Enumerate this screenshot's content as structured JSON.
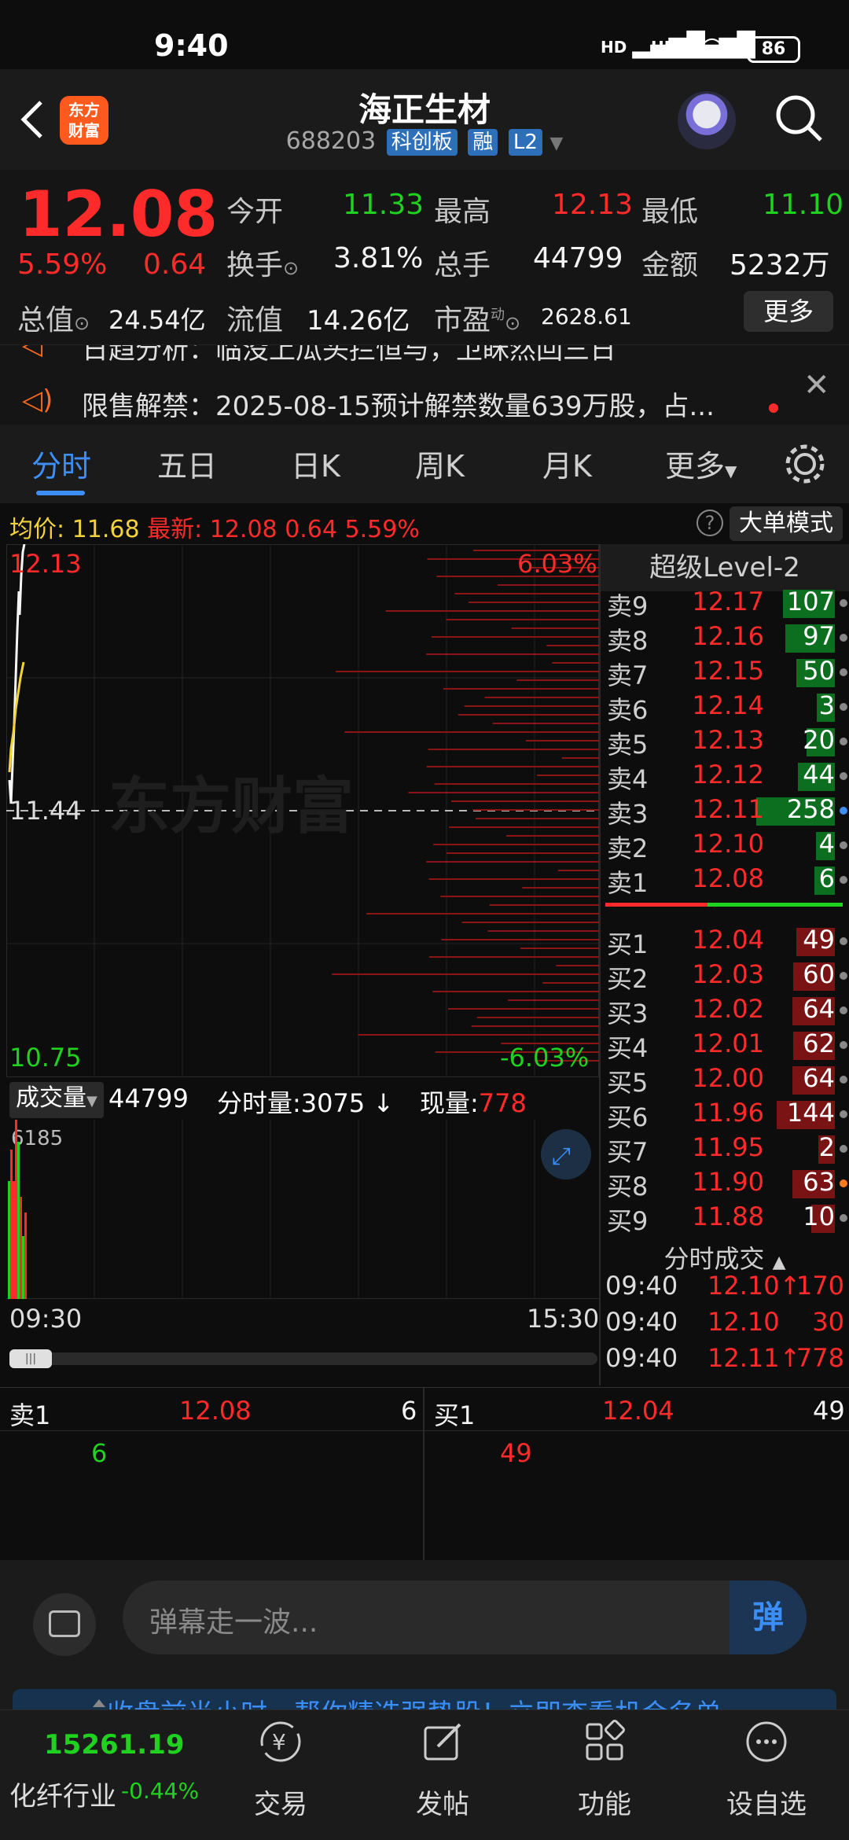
{
  "status": {
    "time": "9:40",
    "sig1": "HD",
    "sig2": "HD",
    "battery": "86"
  },
  "header": {
    "logo_line1": "东方",
    "logo_line2": "财富",
    "title": "海正生材",
    "code": "688203",
    "tag1": "科创板",
    "tag2": "融",
    "tag3": "L2"
  },
  "quote": {
    "price": "12.08",
    "change_pct": "5.59%",
    "change": "0.64",
    "open_label": "今开",
    "open": "11.33",
    "high_label": "最高",
    "high": "12.13",
    "low_label": "最低",
    "low": "11.10",
    "turnover_label": "换手",
    "turnover": "3.81%",
    "volume_label": "总手",
    "volume": "44799",
    "amount_label": "金额",
    "amount": "5232万",
    "mktcap_label": "总值",
    "mktcap": "24.54亿",
    "float_label": "流值",
    "float": "14.26亿",
    "pe_label": "市盈",
    "pe_sup": "动",
    "pe": "2628.61",
    "more": "更多"
  },
  "notice": {
    "line1": "日趋分析：临没上瓜头拦恒与，卫眯然回三日",
    "line2": "限售解禁：2025-08-15预计解禁数量639万股，占..."
  },
  "tabs": [
    "分时",
    "五日",
    "日K",
    "周K",
    "月K",
    "更多"
  ],
  "avgbar": {
    "avg_label": "均价:",
    "avg": "11.68",
    "latest_label": "最新:",
    "latest": "12.08",
    "chg": "0.64",
    "pct": "5.59%",
    "help": "?",
    "mode": "大单模式"
  },
  "chart_labels": {
    "top": "12.13",
    "top_pct": "6.03%",
    "mid": "11.44",
    "bottom": "10.75",
    "bottom_pct": "-6.03%",
    "watermark": "东方财富",
    "vol_max": "6185",
    "time_start": "09:30",
    "time_end": "15:30"
  },
  "volhead": {
    "btn": "成交量",
    "vol": "44799",
    "fs_label": "分时量:",
    "fs": "3075",
    "now_label": "现量:",
    "now": "778"
  },
  "book": {
    "title": "超级Level-2",
    "sells": [
      {
        "label": "卖9",
        "price": "12.17",
        "vol": "107"
      },
      {
        "label": "卖8",
        "price": "12.16",
        "vol": "97"
      },
      {
        "label": "卖7",
        "price": "12.15",
        "vol": "50"
      },
      {
        "label": "卖6",
        "price": "12.14",
        "vol": "3"
      },
      {
        "label": "卖5",
        "price": "12.13",
        "vol": "20"
      },
      {
        "label": "卖4",
        "price": "12.12",
        "vol": "44"
      },
      {
        "label": "卖3",
        "price": "12.11",
        "vol": "258"
      },
      {
        "label": "卖2",
        "price": "12.10",
        "vol": "4"
      },
      {
        "label": "卖1",
        "price": "12.08",
        "vol": "6"
      }
    ],
    "buys": [
      {
        "label": "买1",
        "price": "12.04",
        "vol": "49"
      },
      {
        "label": "买2",
        "price": "12.03",
        "vol": "60"
      },
      {
        "label": "买3",
        "price": "12.02",
        "vol": "64"
      },
      {
        "label": "买4",
        "price": "12.01",
        "vol": "62"
      },
      {
        "label": "买5",
        "price": "12.00",
        "vol": "64"
      },
      {
        "label": "买6",
        "price": "11.96",
        "vol": "144"
      },
      {
        "label": "买7",
        "price": "11.95",
        "vol": "2"
      },
      {
        "label": "买8",
        "price": "11.90",
        "vol": "63"
      },
      {
        "label": "买9",
        "price": "11.88",
        "vol": "10"
      }
    ]
  },
  "trades": {
    "title": "分时成交",
    "rows": [
      {
        "time": "09:40",
        "price": "12.10↑",
        "vol": "170"
      },
      {
        "time": "09:40",
        "price": "12.10",
        "vol": "30"
      },
      {
        "time": "09:40",
        "price": "12.11↑",
        "vol": "778"
      }
    ]
  },
  "strip": {
    "sell_label": "卖1",
    "sell_price": "12.08",
    "sell_vol": "6",
    "sell_q": "6",
    "buy_label": "买1",
    "buy_price": "12.04",
    "buy_vol": "49",
    "buy_q": "49"
  },
  "comment": {
    "placeholder": "弹幕走一波...",
    "btn": "弹"
  },
  "promo": {
    "text": "收盘前半小时，帮你精选强势股！立即查看机会名单"
  },
  "nav": {
    "index_value": "15261.19",
    "index_name": "化纤行业",
    "index_pct": "-0.44%",
    "items": [
      "交易",
      "发帖",
      "功能",
      "设自选"
    ]
  },
  "colors": {
    "up": "#ff2a2a",
    "down": "#1fd21f",
    "accent": "#3d8ef5",
    "avg_line": "#f3d33a"
  }
}
